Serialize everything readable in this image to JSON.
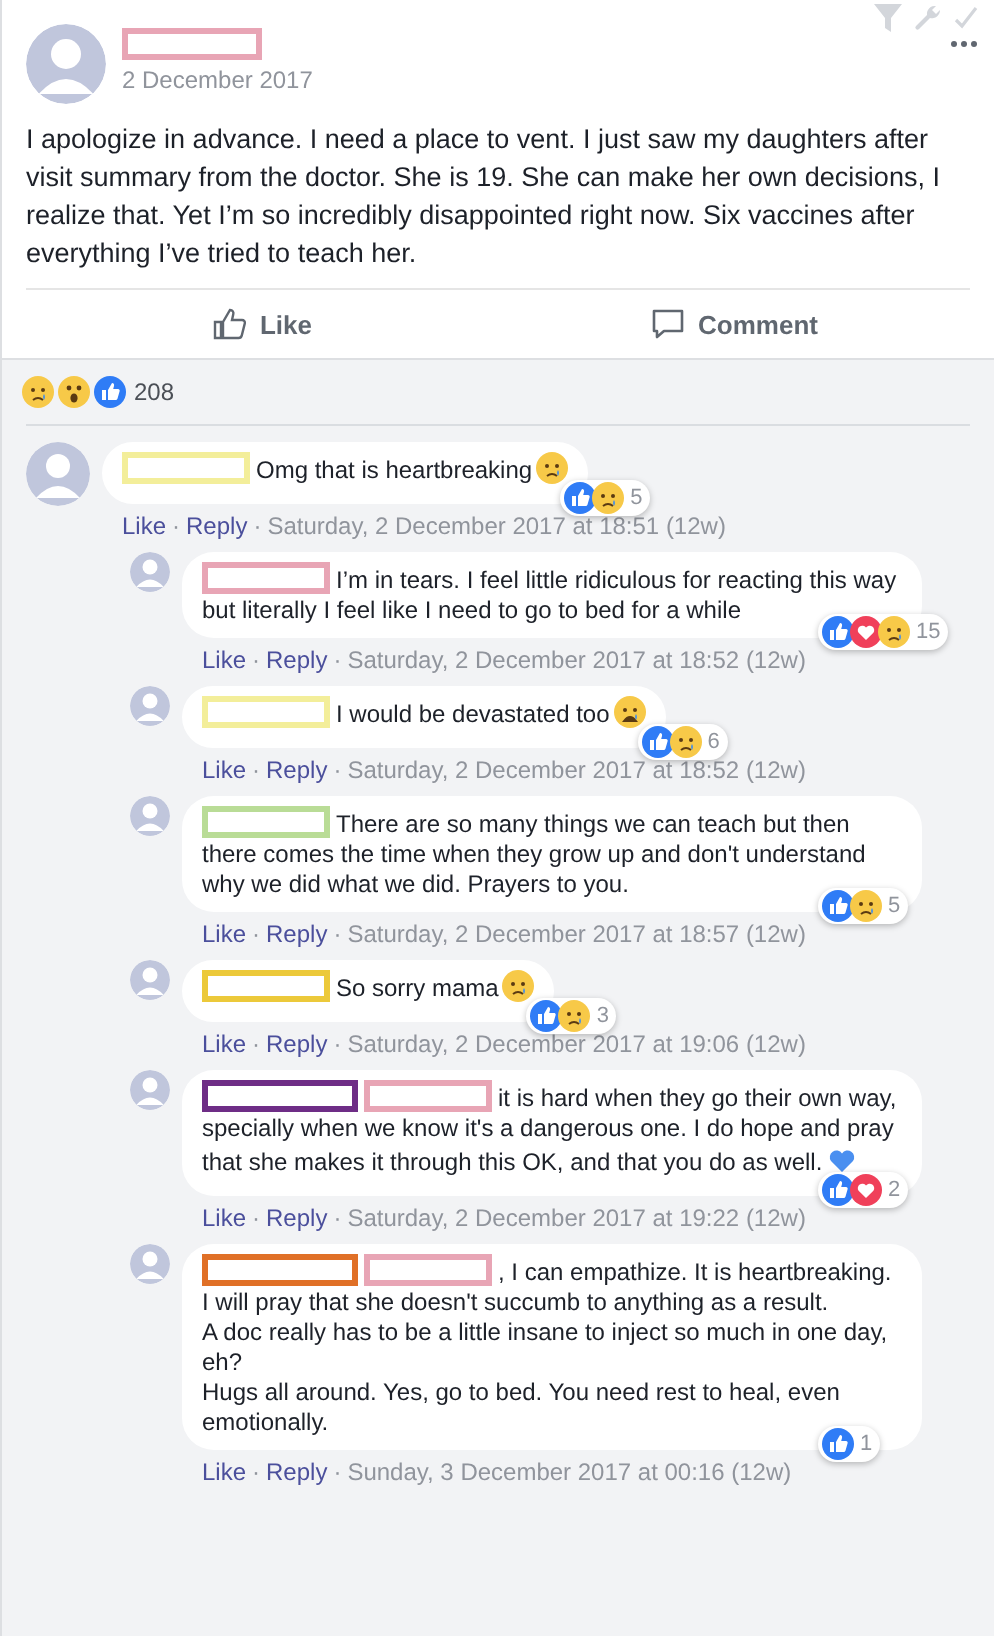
{
  "post": {
    "author": {
      "color": "#e8a5b5"
    },
    "date": "2 December 2017",
    "text": "I apologize in advance. I need a place to vent. I just saw my daughters after visit summary from the doctor. She is 19. She can make her own decisions, I realize that. Yet I’m so incredibly disappointed right now. Six vaccines after everything I’ve tried to teach her.",
    "actions": [
      {
        "kind": "like",
        "label": "Like"
      },
      {
        "kind": "comment",
        "label": "Comment"
      }
    ]
  },
  "reactions_summary": {
    "icons": [
      {
        "kind": "sad"
      },
      {
        "kind": "wow"
      },
      {
        "kind": "like"
      }
    ],
    "count": "208"
  },
  "comments": [
    {
      "names": [
        {
          "color": "#f3ee9a"
        }
      ],
      "text": "Omg that is heartbreaking",
      "emoji": {
        "kind": "crying"
      },
      "reactions": {
        "icons": [
          {
            "kind": "like"
          },
          {
            "kind": "sad"
          }
        ],
        "count": "5"
      },
      "like": "Like",
      "reply": "Reply",
      "separators": [
        "·",
        "·"
      ],
      "time": "Saturday, 2 December 2017 at 18:51 (12w)",
      "children": [
        {
          "names": [
            {
              "color": "#e8a5b5"
            }
          ],
          "text": "I’m in tears. I feel little ridiculous for reacting this way but literally I feel like I need to go to bed for a while",
          "reactions": {
            "icons": [
              {
                "kind": "like"
              },
              {
                "kind": "love"
              },
              {
                "kind": "sad"
              }
            ],
            "count": "15"
          },
          "like": "Like",
          "reply": "Reply",
          "separators": [
            "·",
            "·"
          ],
          "time": "Saturday, 2 December 2017 at 18:52 (12w)"
        },
        {
          "names": [
            {
              "color": "#f3ee9a"
            }
          ],
          "text": "I would be devastated too",
          "emoji": {
            "kind": "weary"
          },
          "reactions": {
            "icons": [
              {
                "kind": "like"
              },
              {
                "kind": "sad"
              }
            ],
            "count": "6"
          },
          "like": "Like",
          "reply": "Reply",
          "separators": [
            "·",
            "·"
          ],
          "time": "Saturday, 2 December 2017 at 18:52 (12w)"
        },
        {
          "names": [
            {
              "color": "#b9dc96"
            }
          ],
          "text": "There are so many things we can teach but then there comes the time when they grow up and don't understand why we did what we did. Prayers to you.",
          "reactions": {
            "icons": [
              {
                "kind": "like"
              },
              {
                "kind": "sad"
              }
            ],
            "count": "5"
          },
          "like": "Like",
          "reply": "Reply",
          "separators": [
            "·",
            "·"
          ],
          "time": "Saturday, 2 December 2017 at 18:57 (12w)"
        },
        {
          "names": [
            {
              "color": "#ecc93a"
            }
          ],
          "text": "So sorry mama",
          "emoji": {
            "kind": "sad"
          },
          "reactions": {
            "icons": [
              {
                "kind": "like"
              },
              {
                "kind": "sad"
              }
            ],
            "count": "3"
          },
          "like": "Like",
          "reply": "Reply",
          "separators": [
            "·",
            "·"
          ],
          "time": "Saturday, 2 December 2017 at 19:06 (12w)"
        },
        {
          "names": [
            {
              "color": "#6e2d86"
            },
            {
              "color": "#e8a5b5"
            }
          ],
          "text": "it is hard when they go their own way, specially when we know it's a dangerous one. I do hope and pray that she makes it through this OK, and that you do as well.",
          "emoji": {
            "kind": "heart"
          },
          "reactions": {
            "icons": [
              {
                "kind": "like"
              },
              {
                "kind": "love"
              }
            ],
            "count": "2"
          },
          "like": "Like",
          "reply": "Reply",
          "separators": [
            "·",
            "·"
          ],
          "time": "Saturday, 2 December 2017 at 19:22 (12w)"
        },
        {
          "names": [
            {
              "color": "#e07027"
            },
            {
              "color": "#e8a5b5"
            }
          ],
          "text": ", I can empathize. It is heartbreaking.\nI will pray that she doesn't succumb to anything as a result.\nA doc really has to be a little insane to inject so much in one day, eh?\nHugs all around. Yes, go to bed. You need rest to heal, even emotionally.",
          "reactions": {
            "icons": [
              {
                "kind": "like"
              }
            ],
            "count": "1"
          },
          "like": "Like",
          "reply": "Reply",
          "separators": [
            "·",
            "·"
          ],
          "time": "Sunday, 3 December 2017 at 00:16 (12w)"
        }
      ]
    }
  ]
}
